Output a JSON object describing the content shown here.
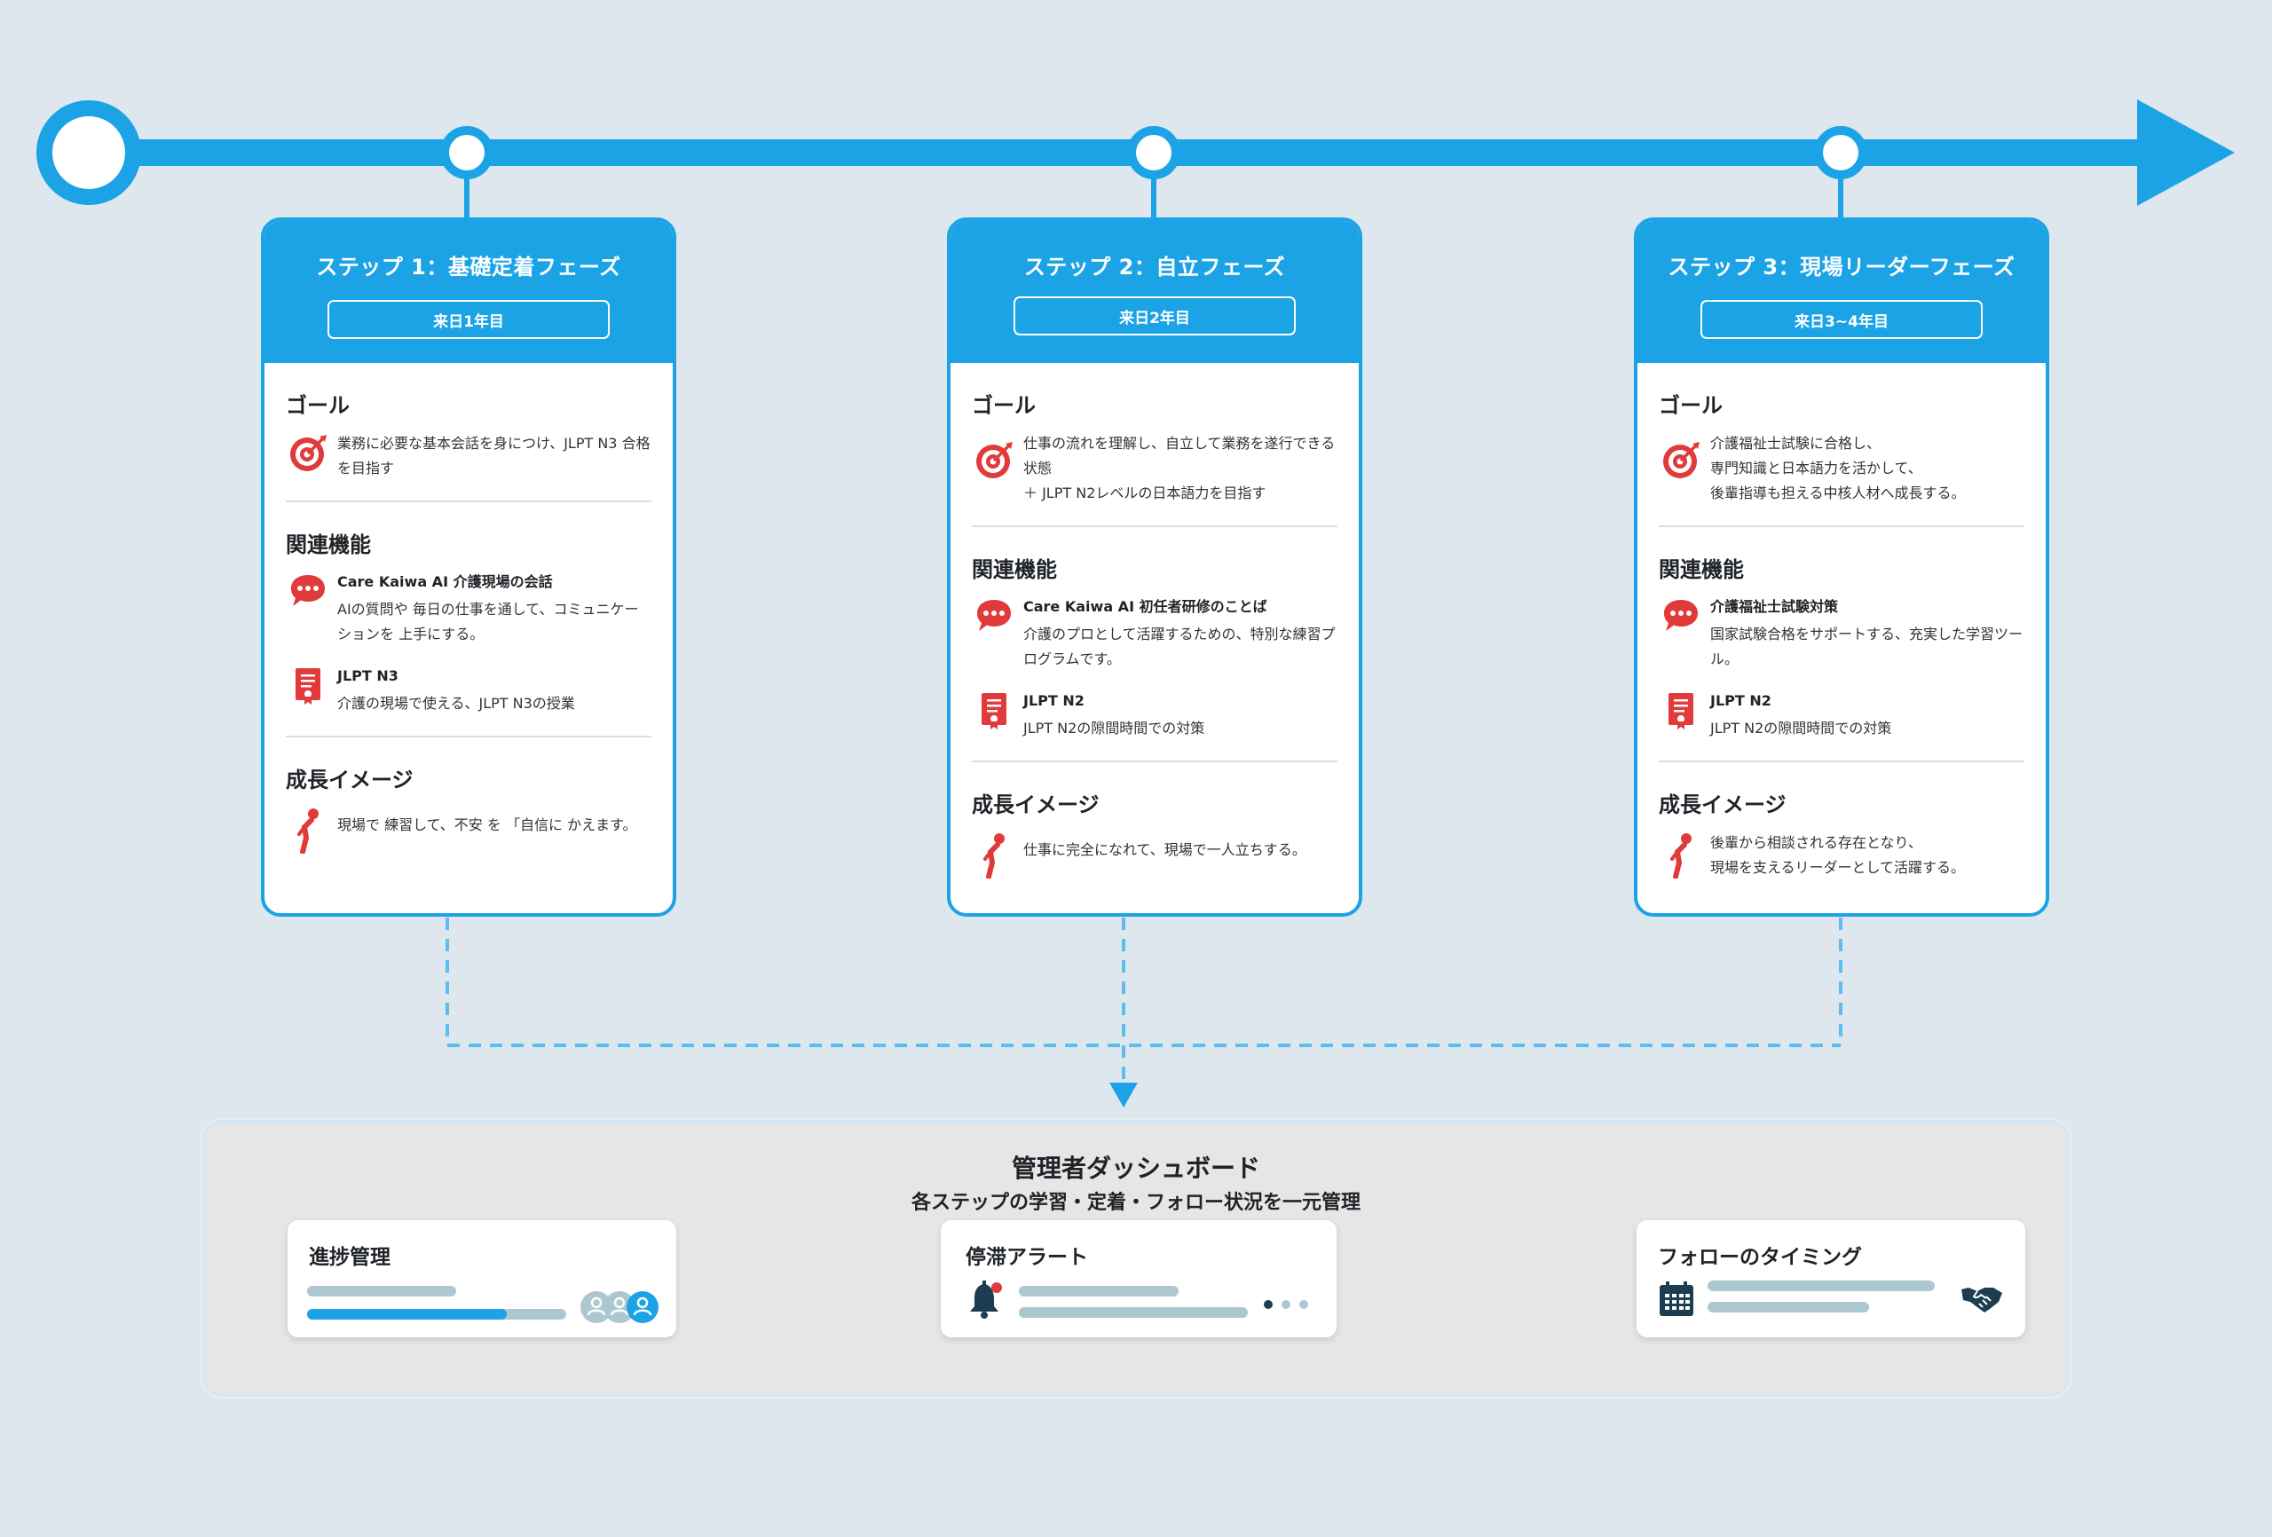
{
  "colors": {
    "accent": "#1ba3e6",
    "icon_red": "#e03a3a",
    "background": "#dfe7ee",
    "dash_bg": "#e6e6e6",
    "placeholder_bar": "#adc7d0",
    "dark_icon": "#1c3c50"
  },
  "steps": [
    {
      "title": "ステップ 1：基礎定着フェーズ",
      "badge": "来日1年目",
      "goal_heading": "ゴール",
      "goal_text": "業務に必要な基本会話を身につけ、JLPT N3 合格を目指す",
      "features_heading": "関連機能",
      "feature1_title": "Care Kaiwa AI 介護現場の会話",
      "feature1_desc": "AIの質問や 毎日の仕事を通して、コミュニケーションを 上手にする。",
      "feature2_title": "JLPT N3",
      "feature2_desc": "介護の現場で使える、JLPT N3の授業",
      "growth_heading": "成長イメージ",
      "growth_text": "現場で 練習して、不安 を 「自信に かえます。"
    },
    {
      "title": "ステップ 2：自立フェーズ",
      "badge": "来日2年目",
      "goal_heading": "ゴール",
      "goal_text": "仕事の流れを理解し、自立して業務を遂行できる状態\n＋ JLPT N2レベルの日本語力を目指す",
      "features_heading": "関連機能",
      "feature1_title": "Care Kaiwa AI 初任者研修のことば",
      "feature1_desc": "介護のプロとして活躍するための、特別な練習プログラムです。",
      "feature2_title": "JLPT N2",
      "feature2_desc": "JLPT N2の隙間時間での対策",
      "growth_heading": "成長イメージ",
      "growth_text": "仕事に完全になれて、現場で一人立ちする。"
    },
    {
      "title": "ステップ 3：現場リーダーフェーズ",
      "badge": "来日3~4年目",
      "goal_heading": "ゴール",
      "goal_text": "介護福祉士試験に合格し、\n専門知識と日本語力を活かして、\n後輩指導も担える中核人材へ成長する。",
      "features_heading": "関連機能",
      "feature1_title": "介護福祉士試験対策",
      "feature1_desc": "国家試験合格をサポートする、充実した学習ツール。",
      "feature2_title": "JLPT N2",
      "feature2_desc": "JLPT N2の隙間時間での対策",
      "growth_heading": "成長イメージ",
      "growth_text": "後輩から相談される存在となり、\n現場を支えるリーダーとして活躍する。"
    }
  ],
  "dashboard": {
    "title": "管理者ダッシュボード",
    "subtitle": "各ステップの学習・定着・フォロー状況を一元管理",
    "progress_title": "進捗管理",
    "progress_fill": 0.77,
    "alert_title": "停滞アラート",
    "follow_title": "フォローのタイミング"
  },
  "icons": {
    "goal": "target-icon",
    "feature_chat": "speech-bubble-icon",
    "feature_cert": "certificate-icon",
    "growth": "person-bowing-icon",
    "users": "users-icon",
    "alert": "bell-icon",
    "calendar": "calendar-icon",
    "handshake": "handshake-icon"
  }
}
